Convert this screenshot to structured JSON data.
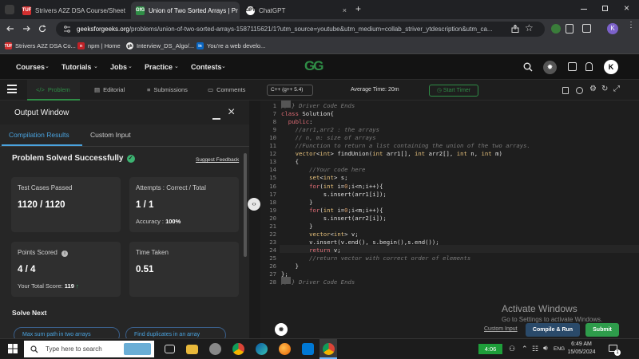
{
  "browser": {
    "tabs": [
      {
        "label": "Strivers A2Z DSA Course/Sheet",
        "favicon": "TUF"
      },
      {
        "label": "Union of Two Sorted Arrays | Pr",
        "favicon": "GfG"
      },
      {
        "label": "ChatGPT",
        "favicon": "GPT"
      }
    ],
    "new_tab": "+",
    "close_glyph": "×",
    "url_host": "geeksforgeeks.org",
    "url_rest": "/problems/union-of-two-sorted-arrays-1587115621/1?utm_source=youtube&utm_medium=collab_striver_ytdescription&utm_ca...",
    "profile_initial": "K",
    "bookmarks": [
      {
        "label": "Strivers A2Z DSA Co...",
        "icon": "TUF"
      },
      {
        "label": "npm | Home",
        "icon": "n"
      },
      {
        "label": "Interview_DS_Algo/...",
        "icon": "gh"
      },
      {
        "label": "You're a web develo...",
        "icon": "in"
      }
    ]
  },
  "gfg": {
    "nav": [
      "Courses",
      "Tutorials",
      "Jobs",
      "Practice",
      "Contests"
    ],
    "logo_text": "GG",
    "avatar_initial": "K"
  },
  "subnav": {
    "tabs": [
      "Problem",
      "Editorial",
      "Submissions",
      "Comments"
    ],
    "language": "C++ (g++ 5.4)",
    "avg_time": "Average Time: 20m",
    "start_timer": "Start Timer"
  },
  "output": {
    "title": "Output Window",
    "tabs": [
      "Compilation Results",
      "Custom Input"
    ],
    "status": "Problem Solved Successfully",
    "suggest_feedback": "Suggest Feedback",
    "test_cases_label": "Test Cases Passed",
    "test_cases_value": "1120 / 1120",
    "attempts_label": "Attempts : Correct / Total",
    "attempts_value": "1 / 1",
    "accuracy_label": "Accuracy : ",
    "accuracy_value": "100%",
    "points_label": "Points Scored",
    "points_value": "4 / 4",
    "total_score_label": "Your Total Score: ",
    "total_score_value": "119",
    "time_label": "Time Taken",
    "time_value": "0.51",
    "solve_next": "Solve Next",
    "next_items": [
      "Max sum path in two arrays",
      "Find duplicates in an array"
    ]
  },
  "editor": {
    "lines": [
      {
        "n": "1",
        "html": "<span class=\"cm\">// } Driver Code Ends</span>"
      },
      {
        "n": "7",
        "html": "<span class=\"kw\">class</span> Solution{"
      },
      {
        "n": "8",
        "html": "  <span class=\"kw\">public</span>:"
      },
      {
        "n": "9",
        "html": "    <span class=\"cm\">//arr1,arr2 : the arrays</span>"
      },
      {
        "n": "10",
        "html": "    <span class=\"cm\">// n, m: size of arrays</span>"
      },
      {
        "n": "11",
        "html": "    <span class=\"cm\">//Function to return a list containing the union of the two arrays.</span>"
      },
      {
        "n": "12",
        "html": "    <span class=\"ty\">vector</span>&lt;<span class=\"ty\">int</span>&gt; findUnion(<span class=\"ty\">int</span> arr1[], <span class=\"ty\">int</span> arr2[], <span class=\"ty\">int</span> n, <span class=\"ty\">int</span> m)"
      },
      {
        "n": "13",
        "html": "    {"
      },
      {
        "n": "14",
        "html": "        <span class=\"cm\">//Your code here</span>"
      },
      {
        "n": "15",
        "html": "        <span class=\"ty\">set</span>&lt;<span class=\"ty\">int</span>&gt; s;"
      },
      {
        "n": "16",
        "html": "        <span class=\"kw\">for</span>(<span class=\"ty\">int</span> i=<span class=\"nm\">0</span>;i&lt;n;i++){"
      },
      {
        "n": "17",
        "html": "            s.insert(arr1[i]);"
      },
      {
        "n": "18",
        "html": "        }"
      },
      {
        "n": "19",
        "html": "        <span class=\"kw\">for</span>(<span class=\"ty\">int</span> i=<span class=\"nm\">0</span>;i&lt;m;i++){"
      },
      {
        "n": "20",
        "html": "            s.insert(arr2[i]);"
      },
      {
        "n": "21",
        "html": "        }"
      },
      {
        "n": "22",
        "html": "        <span class=\"ty\">vector</span>&lt;<span class=\"ty\">int</span>&gt; v;"
      },
      {
        "n": "23",
        "html": "        v.insert(v.end(), s.begin(),s.end());"
      },
      {
        "n": "24",
        "html": "        <span class=\"kw\">return</span> v;"
      },
      {
        "n": "25",
        "html": "        <span class=\"cm\">//return vector with correct order of elements</span>"
      },
      {
        "n": "26",
        "html": "    }"
      },
      {
        "n": "27",
        "html": "};"
      },
      {
        "n": "28",
        "html": "<span class=\"cm\">// } Driver Code Ends</span>"
      }
    ],
    "activate_title": "Activate Windows",
    "activate_sub": "Go to Settings to activate Windows.",
    "custom_input": "Custom Input",
    "compile_run": "Compile & Run",
    "submit": "Submit"
  },
  "taskbar": {
    "search_placeholder": "Type here to search",
    "battery": "4:06",
    "lang": "ENG",
    "time": "6:49 AM",
    "date": "15/05/2024",
    "notifications": "1"
  },
  "colors": {
    "gfg_green": "#2f8d46",
    "success": "#3cb371",
    "submit": "#2e9c4b"
  }
}
